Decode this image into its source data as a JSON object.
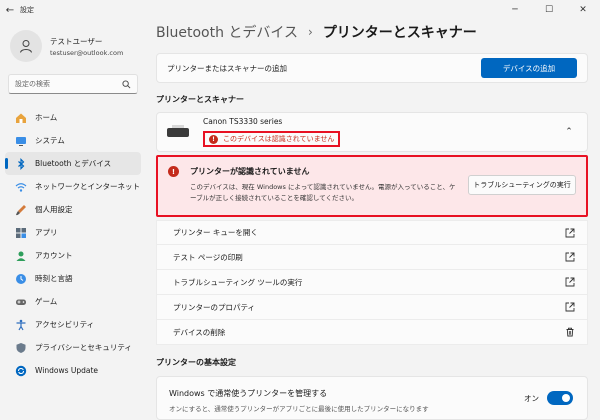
{
  "window": {
    "title": "設定",
    "back_icon": "←",
    "minimize_icon": "─",
    "maximize_icon": "☐",
    "close_icon": "✕"
  },
  "profile": {
    "name": "テストユーザー",
    "email": "testuser@outlook.com"
  },
  "search": {
    "placeholder": "設定の検索"
  },
  "sidebar": {
    "items": [
      {
        "label": "ホーム",
        "icon": "home-icon"
      },
      {
        "label": "システム",
        "icon": "system-icon"
      },
      {
        "label": "Bluetooth とデバイス",
        "icon": "bluetooth-icon",
        "active": true
      },
      {
        "label": "ネットワークとインターネット",
        "icon": "wifi-icon"
      },
      {
        "label": "個人用設定",
        "icon": "brush-icon"
      },
      {
        "label": "アプリ",
        "icon": "apps-icon"
      },
      {
        "label": "アカウント",
        "icon": "account-icon"
      },
      {
        "label": "時刻と言語",
        "icon": "time-language-icon"
      },
      {
        "label": "ゲーム",
        "icon": "gaming-icon"
      },
      {
        "label": "アクセシビリティ",
        "icon": "accessibility-icon"
      },
      {
        "label": "プライバシーとセキュリティ",
        "icon": "shield-icon"
      },
      {
        "label": "Windows Update",
        "icon": "windows-update-icon"
      }
    ]
  },
  "breadcrumb": {
    "parent": "Bluetooth とデバイス",
    "separator": "›",
    "current": "プリンターとスキャナー"
  },
  "add_device": {
    "label": "プリンターまたはスキャナーの追加",
    "button": "デバイスの追加"
  },
  "printers_section": {
    "title": "プリンターとスキャナー"
  },
  "printer": {
    "name": "Canon TS3330 series",
    "status": "このデバイスは認識されていません",
    "status_icon": "!",
    "chevron": "⌃"
  },
  "alert": {
    "icon": "!",
    "title": "プリンターが認識されていません",
    "description": "このデバイスは、現在 Windows によって認識されていません。電源が入っていること、ケーブルが正しく接続されていることを確認してください。",
    "button": "トラブルシューティングの実行"
  },
  "actions": [
    {
      "label": "プリンター キューを開く",
      "icon": "open-external-icon"
    },
    {
      "label": "テスト ページの印刷",
      "icon": "open-external-icon"
    },
    {
      "label": "トラブルシューティング ツールの実行",
      "icon": "open-external-icon"
    },
    {
      "label": "プリンターのプロパティ",
      "icon": "open-external-icon"
    },
    {
      "label": "デバイスの削除",
      "icon": "trash-icon"
    }
  ],
  "prefs_section": {
    "title": "プリンターの基本設定"
  },
  "default_printer_pref": {
    "title": "Windows で通常使うプリンターを管理する",
    "description": "オンにすると、通常使うプリンターがアプリごとに最後に使用したプリンターになります",
    "state_label": "オン",
    "enabled": true
  },
  "colors": {
    "accent": "#0067c0",
    "error": "#c42b1c",
    "highlight_border": "#e81123",
    "alert_bg": "#fde7e9"
  }
}
